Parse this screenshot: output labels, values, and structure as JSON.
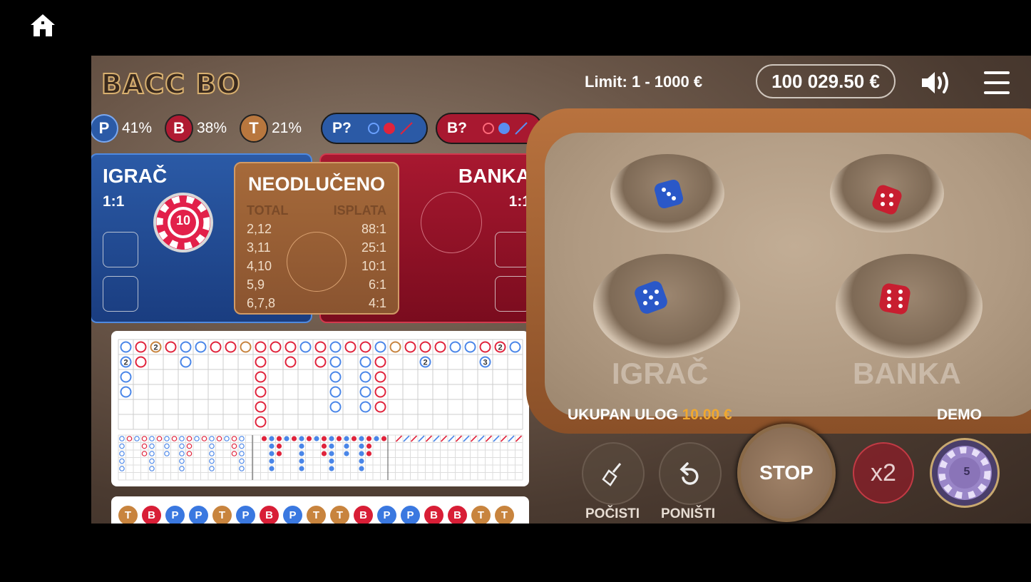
{
  "game": {
    "logo": "BACC BO",
    "limit": "Limit: 1  - 1000 €",
    "balance": "100 029.50 €"
  },
  "stats": {
    "player_letter": "P",
    "player_pct": "41%",
    "banker_letter": "B",
    "banker_pct": "38%",
    "tie_letter": "T",
    "tie_pct": "21%",
    "player_prediction": "P?",
    "banker_prediction": "B?"
  },
  "bets": {
    "player_title": "IGRAČ",
    "player_odds": "1:1",
    "player_chip_value": "10",
    "banker_title": "BANKA",
    "banker_odds": "1:1",
    "tie_title": "NEODLUČENO",
    "tie_header_total": "TOTAL",
    "tie_header_payout": "ISPLATA",
    "tie_rows": [
      {
        "total": "2,12",
        "payout": "88:1"
      },
      {
        "total": "3,11",
        "payout": "25:1"
      },
      {
        "total": "4,10",
        "payout": "10:1"
      },
      {
        "total": "5,9",
        "payout": "6:1"
      },
      {
        "total": "6,7,8",
        "payout": "4:1"
      }
    ]
  },
  "bead_markers": {
    "two": "2",
    "three": "3"
  },
  "history": [
    "T",
    "B",
    "P",
    "P",
    "T",
    "P",
    "B",
    "P",
    "T",
    "T",
    "B",
    "P",
    "P",
    "B",
    "B",
    "T",
    "T"
  ],
  "table": {
    "player_label": "IGRAČ",
    "banker_label": "BANKA"
  },
  "footer": {
    "total_bet_label": "UKUPAN ULOG",
    "total_bet_value": "10.00 €",
    "demo": "DEMO",
    "clear_label": "POČISTI",
    "undo_label": "PONIŠTI",
    "stop_label": "STOP",
    "double_label": "x2",
    "chip_value": "5"
  },
  "colors": {
    "player": "#2b5aa6",
    "banker": "#a81830",
    "tie": "#b8773e",
    "accent": "#f0a830"
  }
}
